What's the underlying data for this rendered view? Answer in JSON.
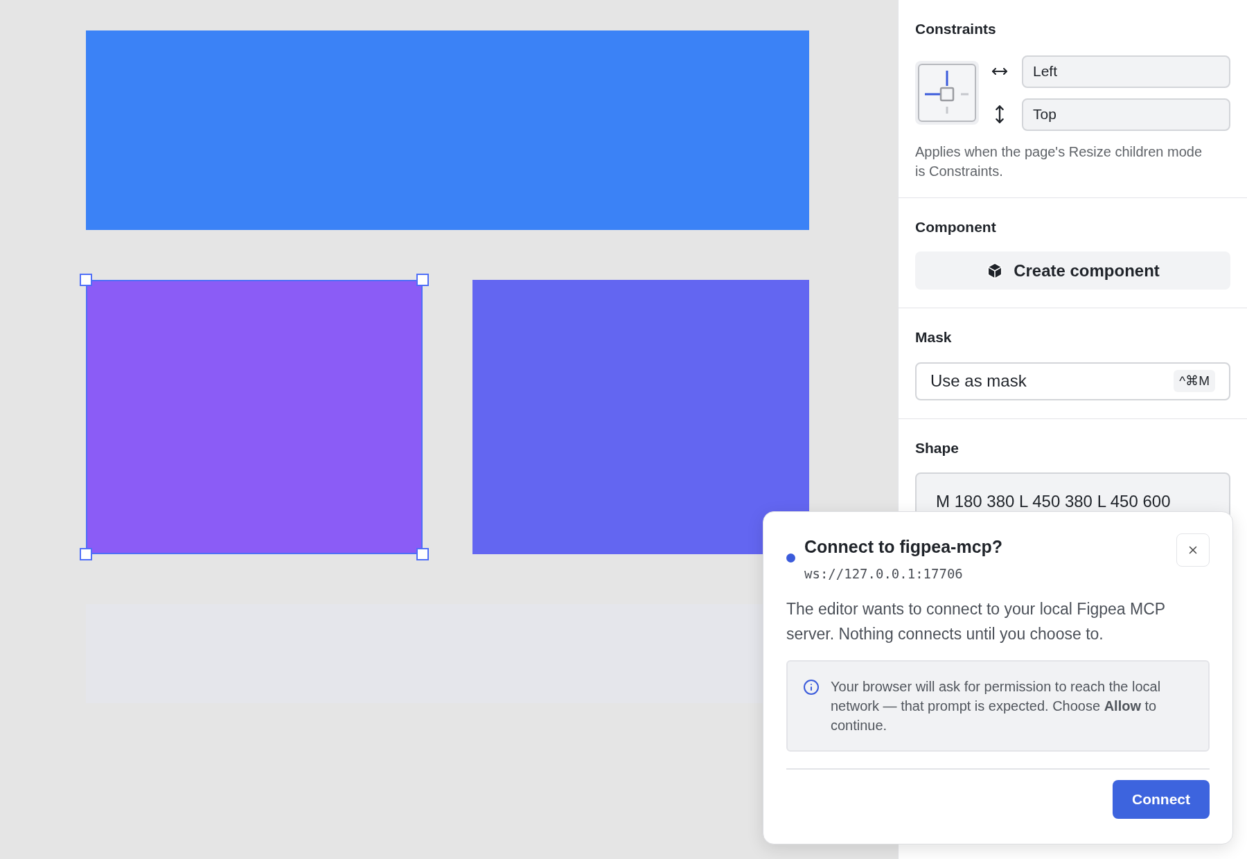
{
  "canvas": {
    "shapes": [
      {
        "kind": "wide",
        "color": "#3b82f6",
        "selected": false
      },
      {
        "kind": "half",
        "color": "#8b5cf6",
        "selected": true
      },
      {
        "kind": "half",
        "color": "#6366f1",
        "selected": false
      },
      {
        "kind": "wide",
        "color": "#e5e6eb",
        "selected": false
      }
    ]
  },
  "panel": {
    "constraints": {
      "title": "Constraints",
      "horizontal": "Left",
      "vertical": "Top",
      "note": "Applies when the page's Resize children mode is Constraints."
    },
    "component": {
      "title": "Component",
      "button": "Create component"
    },
    "mask": {
      "title": "Mask",
      "label": "Use as mask",
      "shortcut": "^⌘M"
    },
    "shape": {
      "title": "Shape",
      "value": "M 180 380 L 450 380 L 450 600"
    }
  },
  "dialog": {
    "title": "Connect to figpea-mcp?",
    "address": "ws://127.0.0.1:17706",
    "body": "The editor wants to connect to your local Figpea MCP server. Nothing connects until you choose to.",
    "notice": "Your browser will ask for permission to reach the local network — that prompt is expected. Choose **Allow** to continue.",
    "button": "Connect"
  }
}
